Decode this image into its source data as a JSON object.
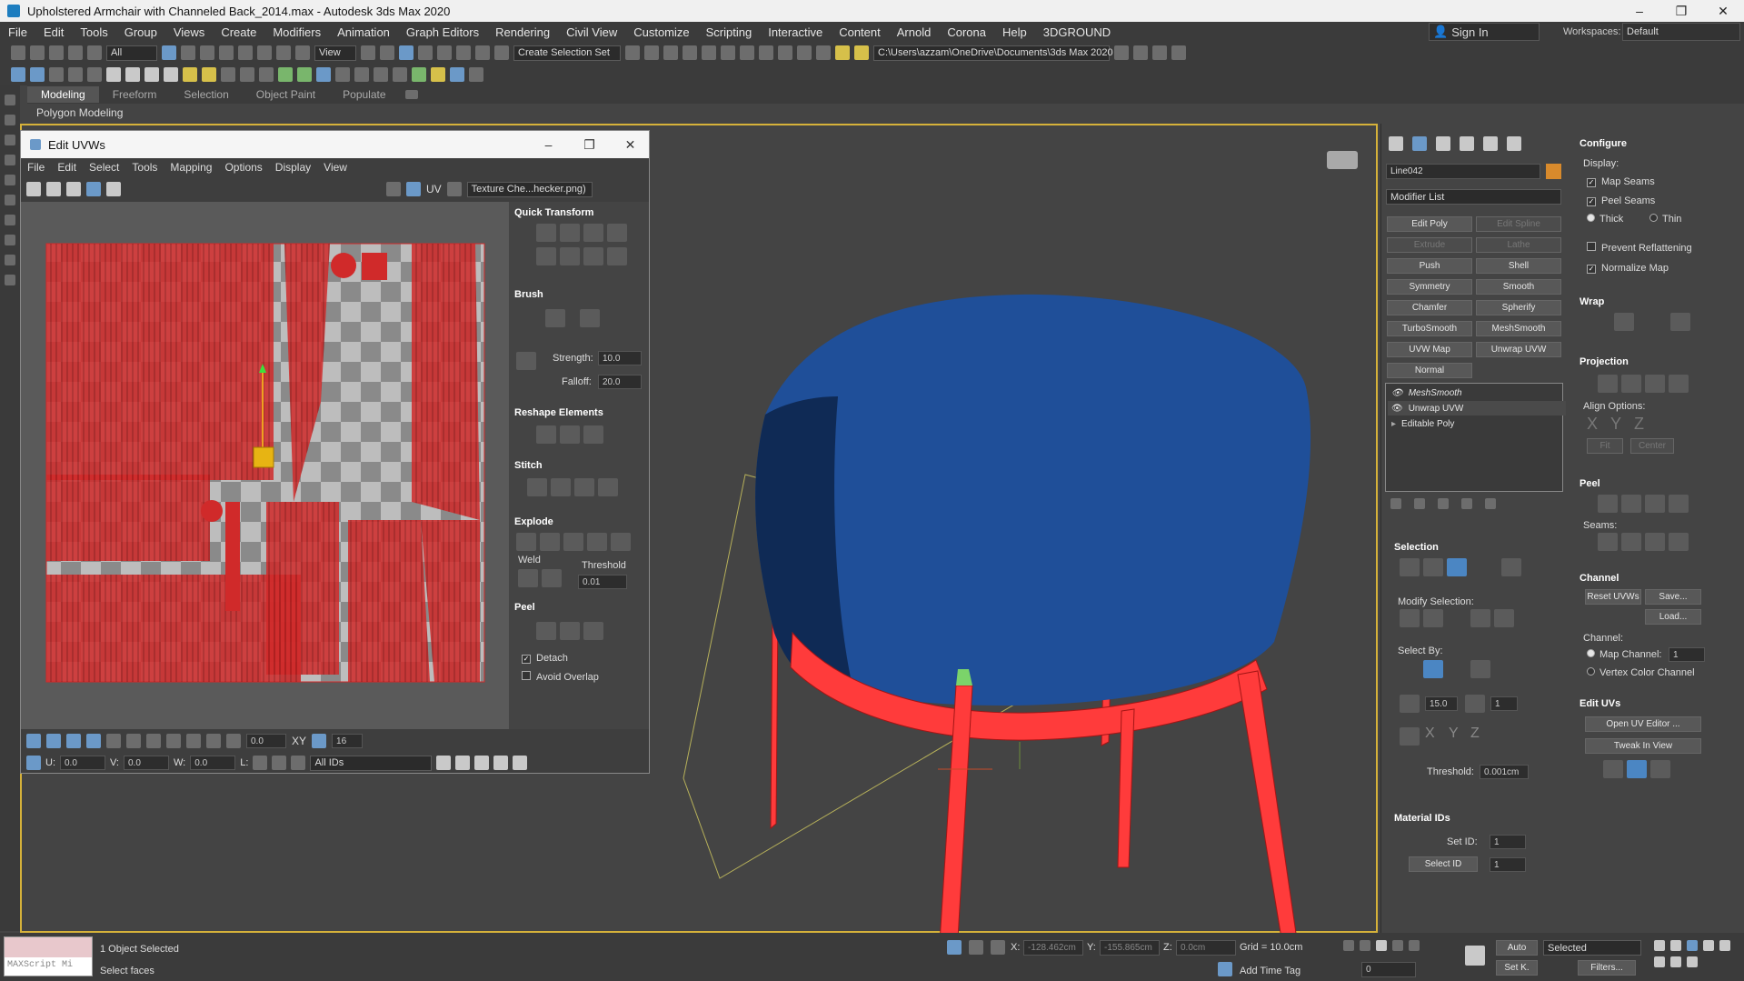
{
  "window": {
    "title": "Upholstered Armchair with Channeled Back_2014.max - Autodesk 3ds Max 2020",
    "controls": [
      "–",
      "❐",
      "✕"
    ]
  },
  "menubar": [
    "File",
    "Edit",
    "Tools",
    "Group",
    "Views",
    "Create",
    "Modifiers",
    "Animation",
    "Graph Editors",
    "Rendering",
    "Civil View",
    "Customize",
    "Scripting",
    "Interactive",
    "Content",
    "Arnold",
    "Corona",
    "Help",
    "3DGROUND"
  ],
  "account": {
    "sign_in": "Sign In",
    "workspaces_label": "Workspaces:",
    "workspace": "Default"
  },
  "toolbar": {
    "filter": "All",
    "refcoord": "View",
    "selection_set": "Create Selection Set",
    "project_path": "C:\\Users\\azzam\\OneDrive\\Documents\\3ds Max 2020"
  },
  "ribbon": {
    "tabs": [
      "Modeling",
      "Freeform",
      "Selection",
      "Object Paint",
      "Populate"
    ],
    "active_tab": "Modeling",
    "sub": "Polygon Modeling"
  },
  "uvw_editor": {
    "title": "Edit UVWs",
    "menu": [
      "File",
      "Edit",
      "Select",
      "Tools",
      "Mapping",
      "Options",
      "Display",
      "View"
    ],
    "uv_label": "UV",
    "texture": "Texture Che...hecker.png)",
    "panels": {
      "quick_transform": "Quick Transform",
      "brush": "Brush",
      "strength_label": "Strength:",
      "strength": "10.0",
      "falloff_label": "Falloff:",
      "falloff": "20.0",
      "reshape": "Reshape Elements",
      "stitch": "Stitch",
      "explode": "Explode",
      "weld": "Weld",
      "threshold_label": "Threshold",
      "threshold": "0.01",
      "peel": "Peel",
      "detach": "Detach",
      "avoid_overlap": "Avoid Overlap"
    },
    "bottom": {
      "rotate_value": "0.0",
      "xy": "XY",
      "grid_value": "16",
      "u_label": "U:",
      "u": "0.0",
      "v_label": "V:",
      "v": "0.0",
      "w_label": "W:",
      "w": "0.0",
      "l_label": "L:",
      "ids": "All IDs"
    }
  },
  "command_panel": {
    "object_name": "Line042",
    "object_color": "#d88a2c",
    "modifier_list": "Modifier List",
    "modifier_buttons": [
      [
        "Edit Poly",
        "Edit Spline"
      ],
      [
        "Extrude",
        "Lathe"
      ],
      [
        "Push",
        "Shell"
      ],
      [
        "Symmetry",
        "Smooth"
      ],
      [
        "Chamfer",
        "Spherify"
      ],
      [
        "TurboSmooth",
        "MeshSmooth"
      ],
      [
        "UVW Map",
        "Unwrap UVW"
      ],
      [
        "Normal",
        ""
      ]
    ],
    "stack": [
      "MeshSmooth",
      "Unwrap UVW",
      "Editable Poly"
    ],
    "selection": {
      "title": "Selection",
      "modify_selection": "Modify Selection:",
      "select_by": "Select By:",
      "angle": "15.0",
      "count": "1",
      "threshold_label": "Threshold:",
      "threshold": "0.001cm"
    },
    "material_ids": {
      "title": "Material IDs",
      "set_id_label": "Set ID:",
      "set_id": "1",
      "select_id_label": "Select ID",
      "select_id": "1"
    },
    "configure": {
      "title": "Configure",
      "display_label": "Display:",
      "map_seams": "Map Seams",
      "peel_seams": "Peel Seams",
      "thick": "Thick",
      "thin": "Thin",
      "prevent_reflattening": "Prevent Reflattening",
      "normalize_map": "Normalize Map"
    },
    "wrap": {
      "title": "Wrap"
    },
    "projection": {
      "title": "Projection",
      "align_options": "Align Options:",
      "axes": [
        "X",
        "Y",
        "Z"
      ],
      "fit": "Fit",
      "center": "Center"
    },
    "peel": {
      "title": "Peel",
      "seams": "Seams:"
    },
    "channel": {
      "title": "Channel",
      "reset_uvws": "Reset UVWs",
      "save": "Save...",
      "load": "Load...",
      "channel_label": "Channel:",
      "map_channel": "Map Channel:",
      "map_channel_value": "1",
      "vertex_color_channel": "Vertex Color Channel"
    },
    "edit_uvs": {
      "title": "Edit UVs",
      "open_editor": "Open UV Editor ...",
      "tweak": "Tweak In View"
    }
  },
  "statusbar": {
    "maxscript": "MAXScript Mi",
    "objects_selected": "1 Object Selected",
    "prompt": "Select faces",
    "x_label": "X:",
    "x": "-128.462cm",
    "y_label": "Y:",
    "y": "-155.865cm",
    "z_label": "Z:",
    "z": "0.0cm",
    "grid": "Grid = 10.0cm",
    "add_time_tag": "Add Time Tag",
    "frame": "0",
    "auto_key": "Auto",
    "set_key": "Set K.",
    "key_filter": "Selected",
    "filters": "Filters..."
  },
  "colors": {
    "uv_red": "#d02a2a",
    "mesh_red": "#ff3b3b",
    "cushion_blue": "#1f4f99",
    "accent_blue": "#4b86c3"
  }
}
